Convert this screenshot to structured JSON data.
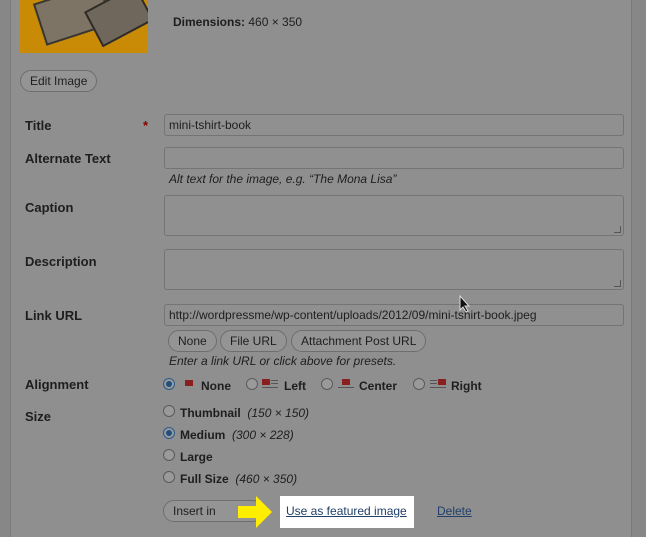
{
  "media": {
    "dimensions_label": "Dimensions:",
    "dimensions_value": "460 × 350",
    "edit_image": "Edit Image"
  },
  "form": {
    "title_label": "Title",
    "required_mark": "*",
    "title_value": "mini-tshirt-book",
    "alt_label": "Alternate Text",
    "alt_value": "",
    "alt_help": "Alt text for the image, e.g. “The Mona Lisa”",
    "caption_label": "Caption",
    "caption_value": "",
    "description_label": "Description",
    "description_value": "",
    "link_label": "Link URL",
    "link_value": "http://wordpressme/wp-content/uploads/2012/09/mini-tshirt-book.jpeg",
    "link_buttons": [
      "None",
      "File URL",
      "Attachment Post URL"
    ],
    "link_help": "Enter a link URL or click above for presets."
  },
  "alignment": {
    "label": "Alignment",
    "options": [
      "None",
      "Left",
      "Center",
      "Right"
    ],
    "selected": "None"
  },
  "size": {
    "label": "Size",
    "options": [
      {
        "name": "Thumbnail",
        "dims": "(150 × 150)"
      },
      {
        "name": "Medium",
        "dims": "(300 × 228)"
      },
      {
        "name": "Large",
        "dims": ""
      },
      {
        "name": "Full Size",
        "dims": "(460 × 350)"
      }
    ],
    "selected": "Medium"
  },
  "actions": {
    "insert_label": "Insert in",
    "featured_link": "Use as featured image",
    "delete_link": "Delete"
  },
  "colors": {
    "arrow": "#ffee00",
    "highlight": "#ffffff",
    "link": "#21406a"
  }
}
